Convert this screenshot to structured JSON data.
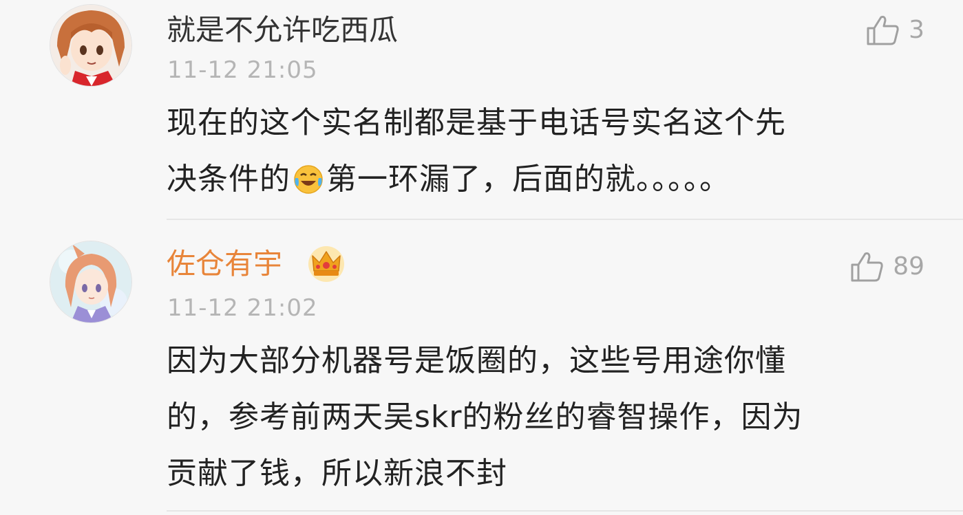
{
  "comments": [
    {
      "username": "就是不允许吃西瓜",
      "timestamp": "11-12 21:05",
      "likes": "3",
      "verified_crown": false,
      "body": {
        "line1": "现在的这个实名制都是基于电话号实名这个先",
        "line2_before_emoji": "决条件的",
        "emoji": "laugh-cry-emoji",
        "line2_after_emoji": "第一环漏了，后面的就。。。。。"
      }
    },
    {
      "username": "佐仓有宇",
      "timestamp": "11-12 21:02",
      "likes": "89",
      "verified_crown": true,
      "body": {
        "line1": "因为大部分机器号是饭圈的，这些号用途你懂",
        "line2": "的，参考前两天吴skr的粉丝的睿智操作，因为",
        "line3": "贡献了钱，所以新浪不封"
      }
    }
  ],
  "colors": {
    "background": "#f7f7f7",
    "username_default": "#333333",
    "username_vip": "#e8853a",
    "timestamp": "#b5b5b5",
    "body_text": "#222222",
    "like_icon": "#a0a0a0"
  }
}
